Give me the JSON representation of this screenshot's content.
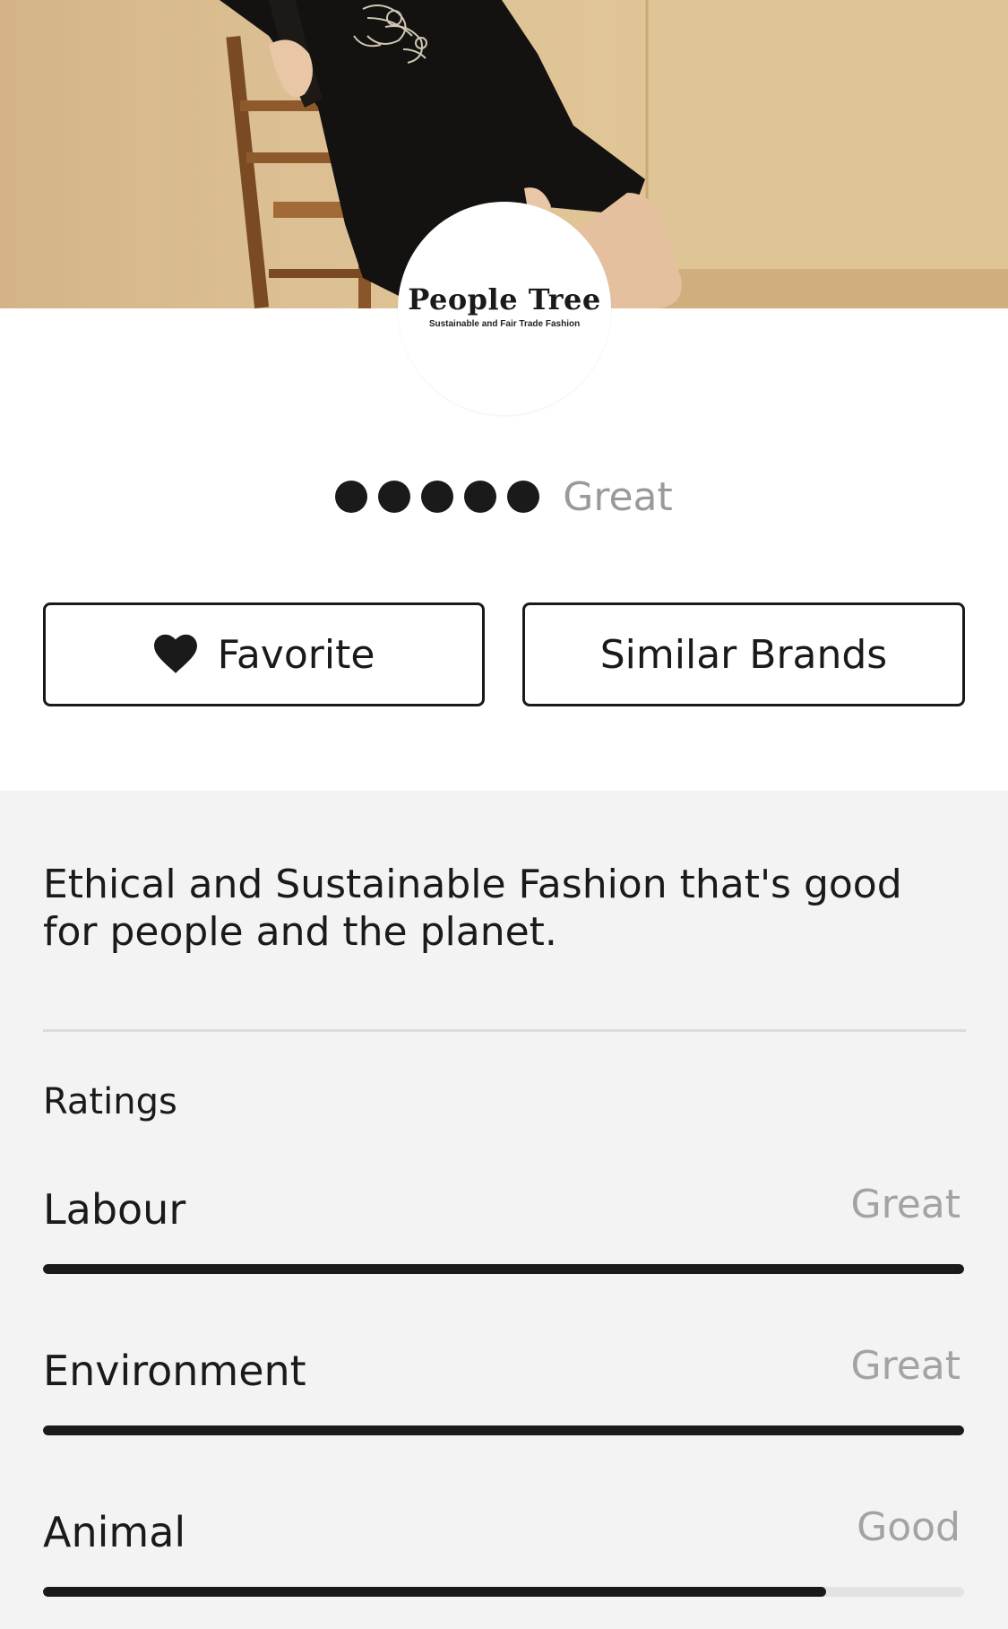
{
  "brand": {
    "logo_name": "People Tree",
    "logo_tagline": "Sustainable and Fair Trade Fashion"
  },
  "hero": {
    "image": "model-seated-on-wooden-chair-black-embroidered-dress"
  },
  "overall_rating": {
    "dots_filled": 5,
    "dots_total": 5,
    "label": "Great"
  },
  "actions": {
    "favorite_label": "Favorite",
    "favorite_icon": "heart-icon",
    "similar_label": "Similar Brands"
  },
  "description": "Ethical and Sustainable Fashion that's good for people and the planet.",
  "ratings": {
    "title": "Ratings",
    "items": [
      {
        "name": "Labour",
        "value": "Great",
        "fill": 1.0
      },
      {
        "name": "Environment",
        "value": "Great",
        "fill": 1.0
      },
      {
        "name": "Animal",
        "value": "Good",
        "fill": 0.85
      }
    ]
  },
  "colors": {
    "text": "#1a1a1a",
    "muted": "#9a9a9a",
    "section_bg": "#f3f3f3",
    "hero_wall": "#dcc093"
  }
}
